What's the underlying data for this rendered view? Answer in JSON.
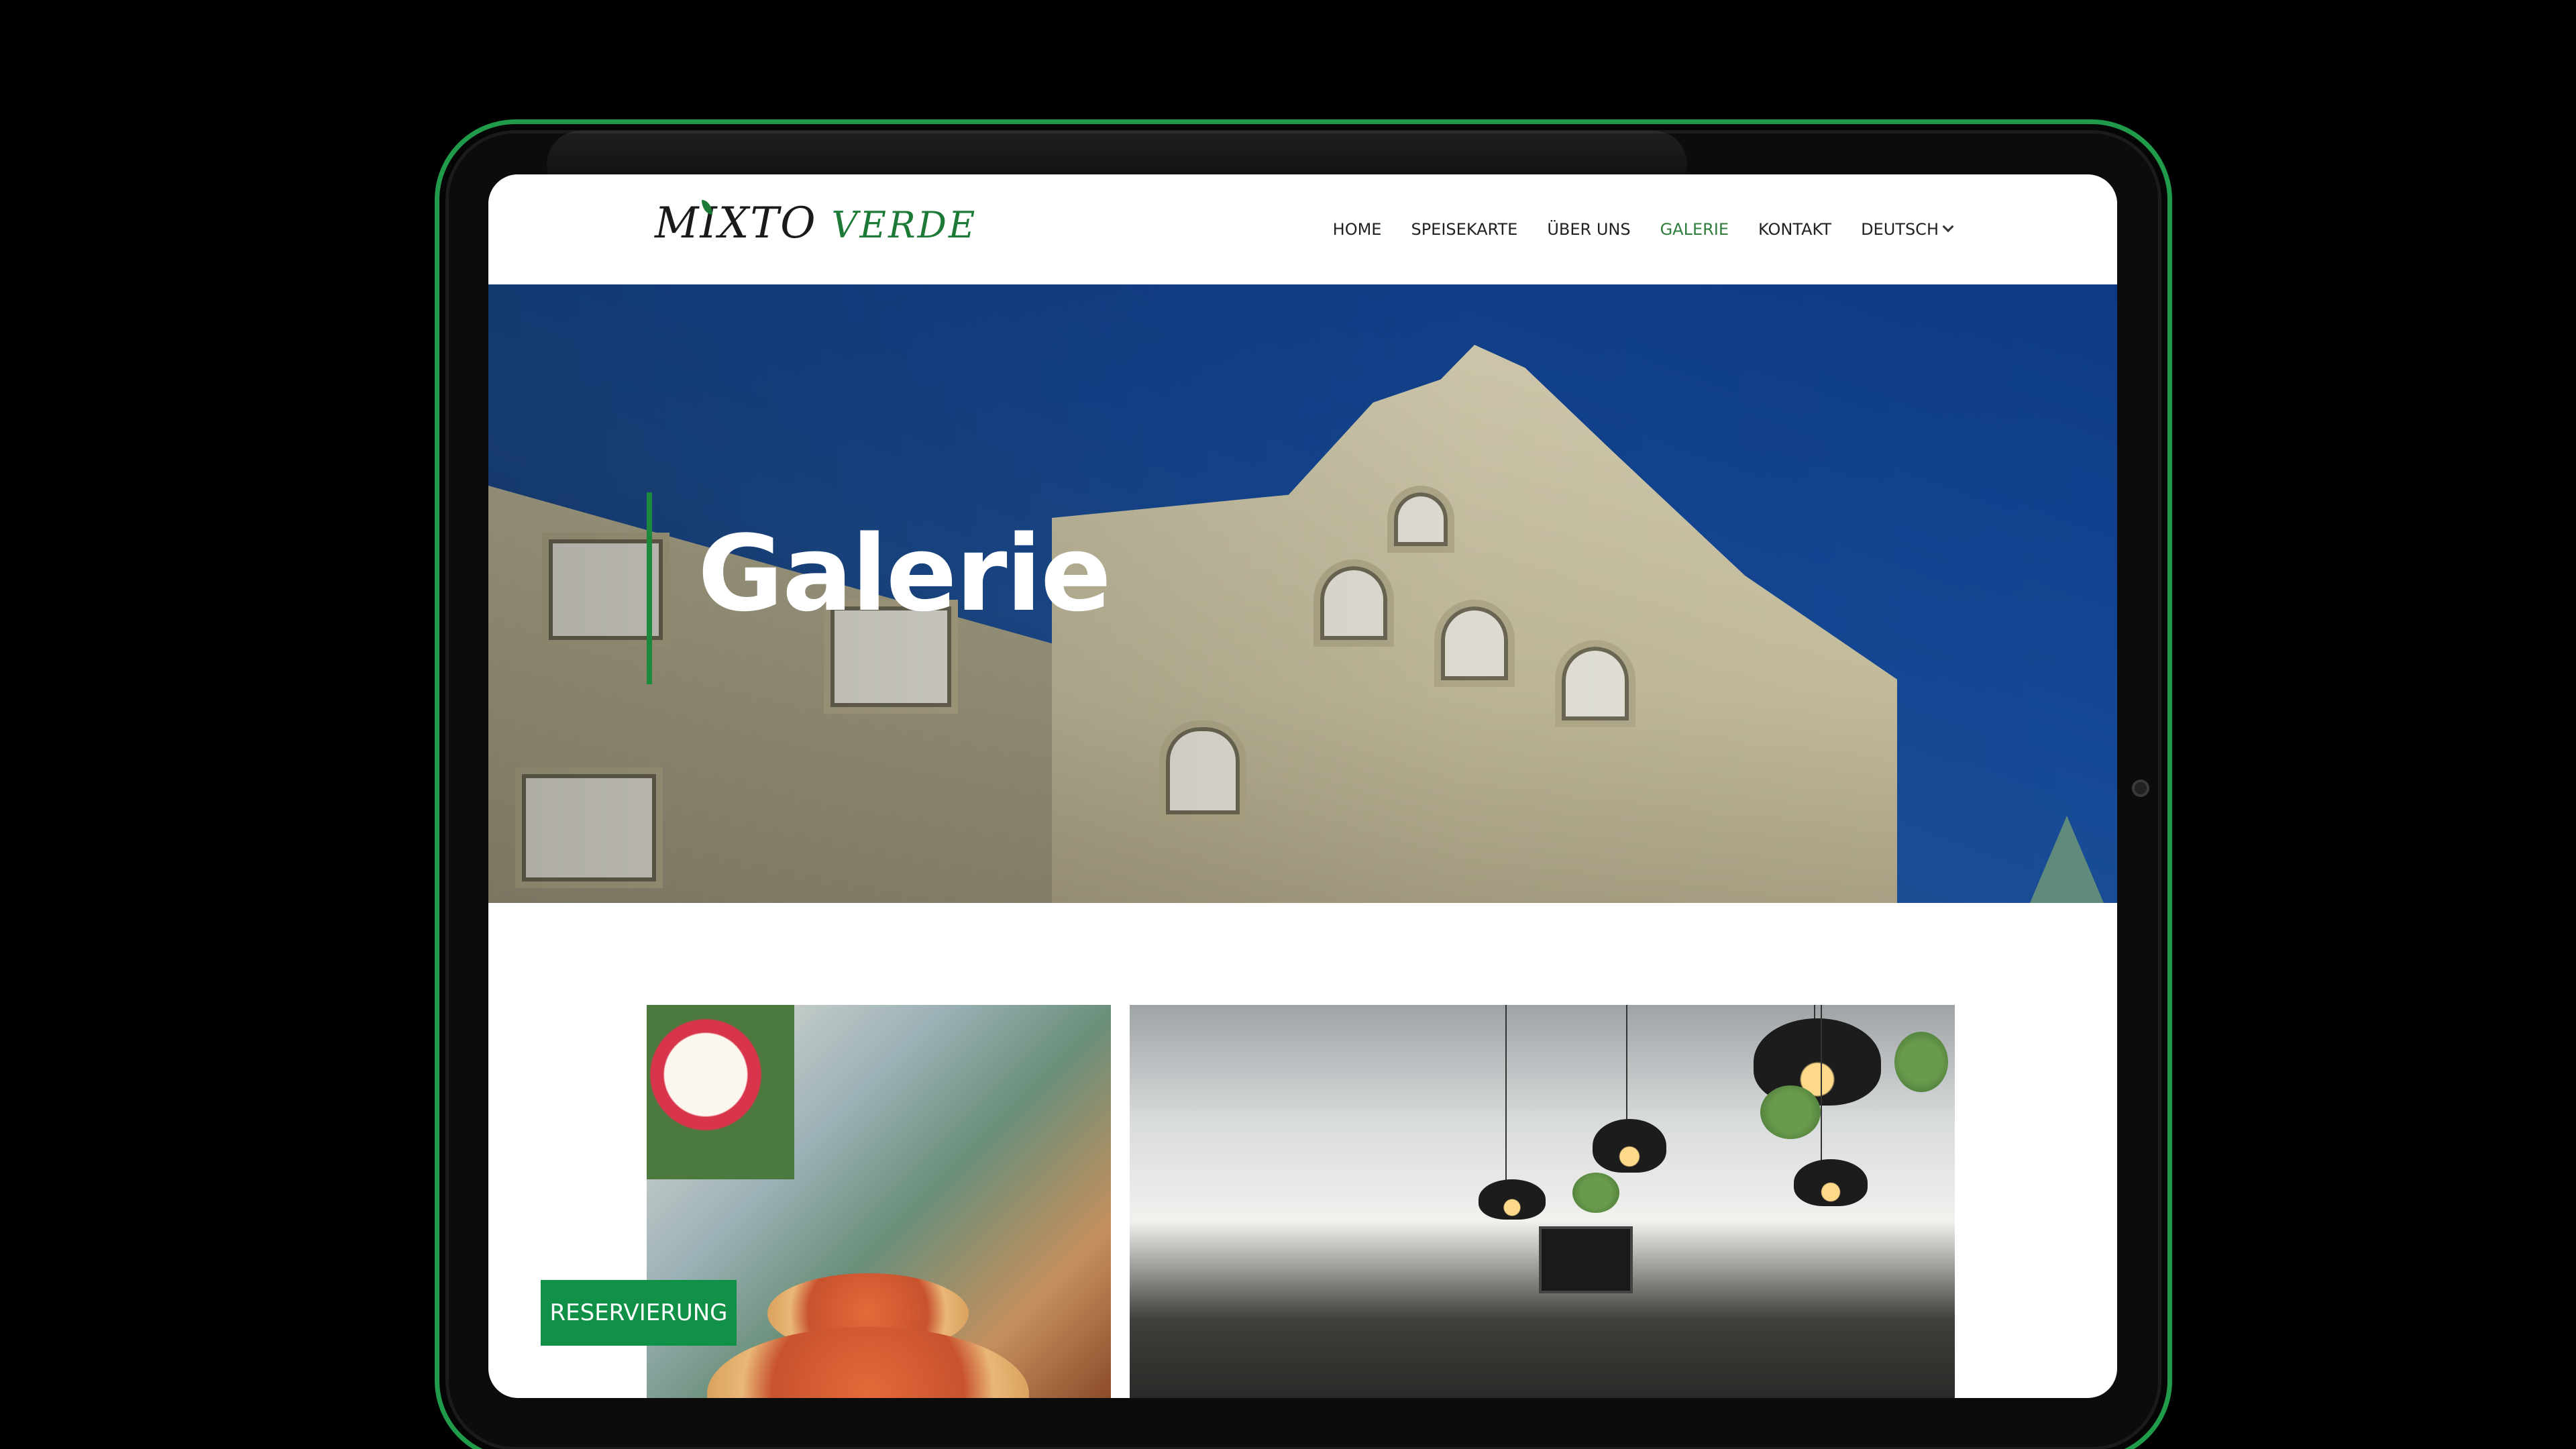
{
  "brand": {
    "logo_word1": "MIXTO",
    "logo_word2": "VERDE",
    "accent_color": "#119147"
  },
  "nav": {
    "items": [
      {
        "label": "HOME"
      },
      {
        "label": "SPEISEKARTE"
      },
      {
        "label": "ÜBER UNS"
      },
      {
        "label": "GALERIE",
        "active": true
      },
      {
        "label": "KONTAKT"
      }
    ],
    "language": "DEUTSCH",
    "language_icon": "chevron-down-icon"
  },
  "hero": {
    "title": "Galerie"
  },
  "actions": {
    "reserve_label": "RESERVIERUNG"
  }
}
